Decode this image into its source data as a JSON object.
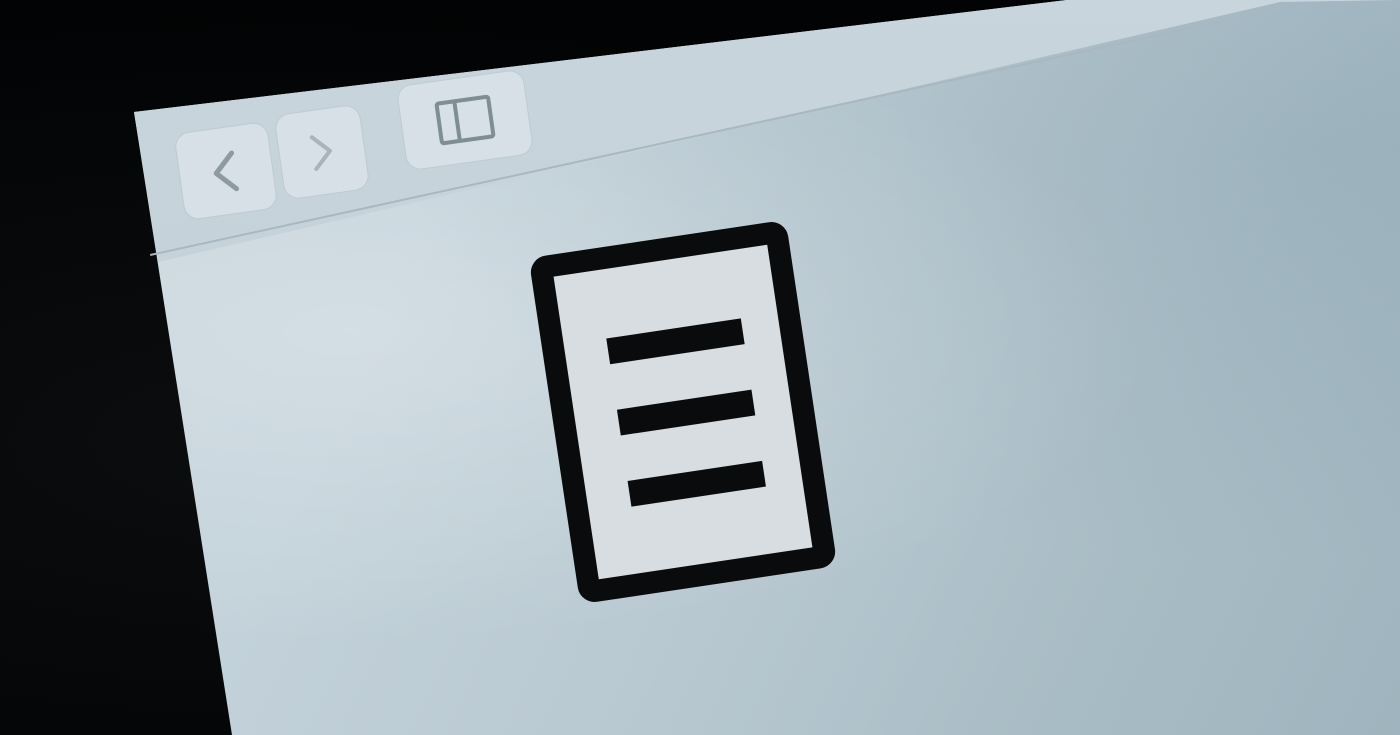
{
  "toolbar": {
    "back_button": {
      "icon": "chevron-left-icon"
    },
    "forward_button": {
      "icon": "chevron-right-icon"
    },
    "sidebar_button": {
      "icon": "sidebar-toggle-icon"
    }
  },
  "content": {
    "icon": "document-lines-icon"
  },
  "colors": {
    "screen": "#c3d2da",
    "icon_stroke": "#0a0b0c",
    "icon_fill": "#d7dde0",
    "button_glyph": "#8d9aa2"
  }
}
